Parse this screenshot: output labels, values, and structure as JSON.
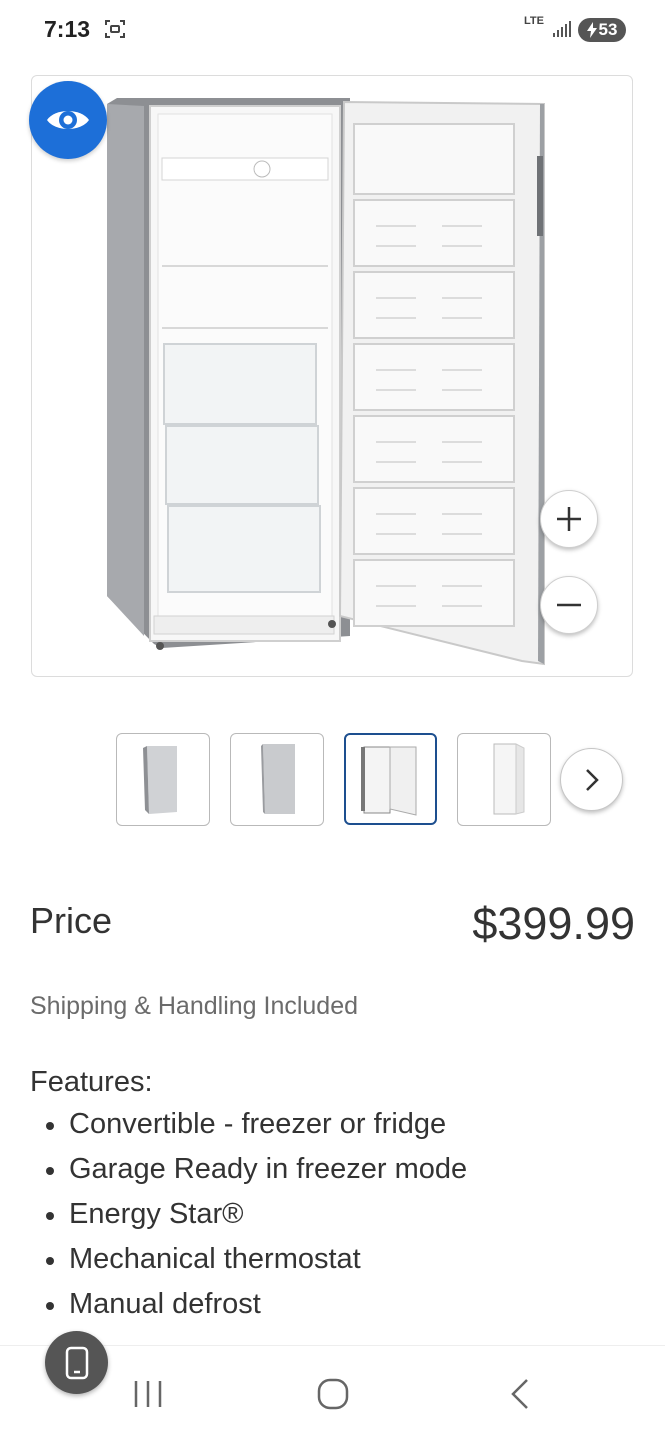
{
  "status_bar": {
    "time": "7:13",
    "network": "LTE",
    "battery": "53"
  },
  "viewer": {
    "view_icon": "eye-icon",
    "zoom_in_icon": "plus-icon",
    "zoom_out_icon": "minus-icon",
    "next_icon": "chevron-right-icon",
    "selected_thumbnail_index": 2
  },
  "product": {
    "price_label": "Price",
    "price": "$399.99",
    "shipping": "Shipping & Handling Included",
    "features_title": "Features:",
    "features": [
      "Convertible - freezer or fridge",
      "Garage Ready in freezer mode",
      "Energy Star®",
      "Mechanical thermostat",
      "Manual defrost"
    ]
  },
  "colors": {
    "accent": "#1d6fd8",
    "selected_border": "#1d4f8f",
    "text": "#333333",
    "muted": "#6b6b6b"
  },
  "nav": {
    "recents_icon": "recents-icon",
    "home_icon": "home-icon",
    "back_icon": "back-icon",
    "phone_icon": "phone-icon"
  }
}
